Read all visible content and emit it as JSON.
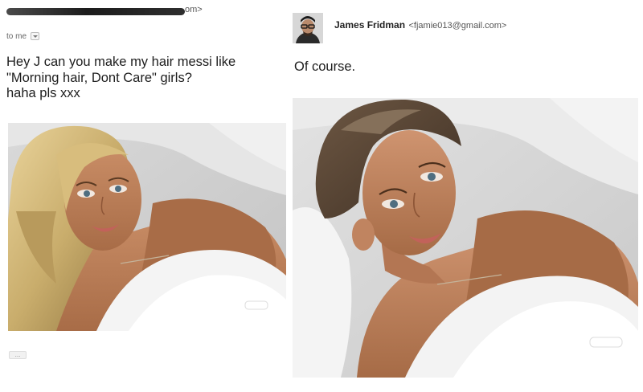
{
  "original_email": {
    "sender_visible_suffix": "om>",
    "recipient_label": "to me",
    "body_lines": [
      "Hey J can you make my hair messi like",
      "\"Morning hair, Dont Care\" girls?",
      "haha pls xxx"
    ],
    "expand_dots": "..."
  },
  "reply_email": {
    "sender_name": "James Fridman",
    "sender_email": "<fjamie013@gmail.com>",
    "body": "Of course."
  },
  "icons": {
    "recipient_dropdown": "chevron-down-icon",
    "avatar": "user-avatar-icon"
  }
}
